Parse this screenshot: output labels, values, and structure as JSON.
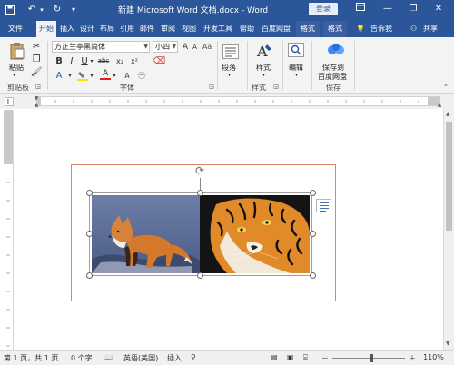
{
  "titlebar": {
    "title": "新建 Microsoft Word 文档.docx - Word",
    "login": "登录",
    "minimize": "—",
    "restore": "❐",
    "close": "✕"
  },
  "tabs": [
    {
      "label": "文件"
    },
    {
      "label": "开始"
    },
    {
      "label": "插入"
    },
    {
      "label": "设计"
    },
    {
      "label": "布局"
    },
    {
      "label": "引用"
    },
    {
      "label": "邮件"
    },
    {
      "label": "审阅"
    },
    {
      "label": "视图"
    },
    {
      "label": "开发工具"
    },
    {
      "label": "帮助"
    },
    {
      "label": "百度网盘"
    },
    {
      "label": "格式"
    },
    {
      "label": "格式"
    }
  ],
  "tell_me": "告诉我",
  "share": "共享",
  "ribbon": {
    "paste_label": "粘贴",
    "clipboard_group": "剪贴板",
    "font_name": "方正兰亭黑简体",
    "font_size": "小四",
    "font_group": "字体",
    "paragraph_label": "段落",
    "styles_label": "样式",
    "styles_group": "样式",
    "edit_label": "编辑",
    "save_to_label_1": "保存到",
    "save_to_label_2": "百度网盘",
    "save_group": "保存",
    "bold": "B",
    "italic": "I",
    "underline": "U",
    "strike": "abc",
    "sub": "x₂",
    "sup": "x²",
    "font_grow": "A",
    "font_shrink": "A",
    "font_color": "A"
  },
  "statusbar": {
    "page": "第 1 页，共 1 页",
    "words": "0 个字",
    "language": "英语(美国)",
    "insert_mode": "插入",
    "zoom": "110%",
    "zoom_minus": "－",
    "zoom_plus": "＋"
  },
  "colors": {
    "word_blue": "#2b579a",
    "ribbon_bg": "#f3f3f3",
    "textbox_border": "#e0826c"
  }
}
